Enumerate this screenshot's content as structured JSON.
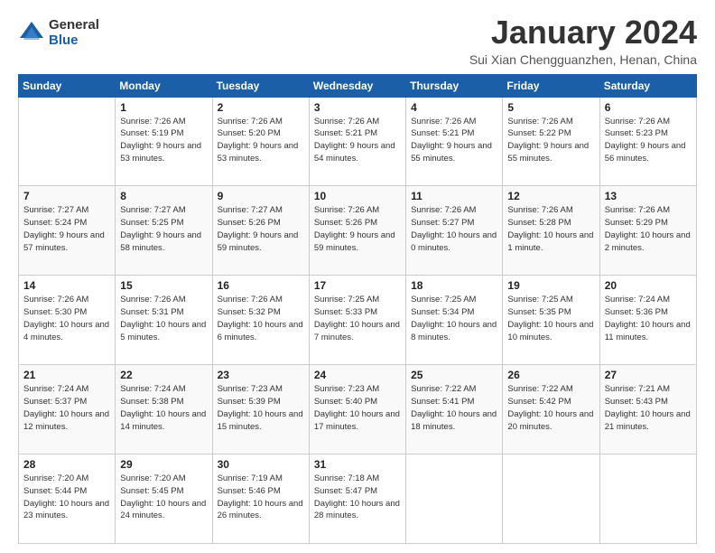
{
  "logo": {
    "general": "General",
    "blue": "Blue"
  },
  "title": {
    "month_year": "January 2024",
    "location": "Sui Xian Chengguanzhen, Henan, China"
  },
  "weekdays": [
    "Sunday",
    "Monday",
    "Tuesday",
    "Wednesday",
    "Thursday",
    "Friday",
    "Saturday"
  ],
  "weeks": [
    [
      {
        "day": "",
        "sunrise": "",
        "sunset": "",
        "daylight": ""
      },
      {
        "day": "1",
        "sunrise": "Sunrise: 7:26 AM",
        "sunset": "Sunset: 5:19 PM",
        "daylight": "Daylight: 9 hours and 53 minutes."
      },
      {
        "day": "2",
        "sunrise": "Sunrise: 7:26 AM",
        "sunset": "Sunset: 5:20 PM",
        "daylight": "Daylight: 9 hours and 53 minutes."
      },
      {
        "day": "3",
        "sunrise": "Sunrise: 7:26 AM",
        "sunset": "Sunset: 5:21 PM",
        "daylight": "Daylight: 9 hours and 54 minutes."
      },
      {
        "day": "4",
        "sunrise": "Sunrise: 7:26 AM",
        "sunset": "Sunset: 5:21 PM",
        "daylight": "Daylight: 9 hours and 55 minutes."
      },
      {
        "day": "5",
        "sunrise": "Sunrise: 7:26 AM",
        "sunset": "Sunset: 5:22 PM",
        "daylight": "Daylight: 9 hours and 55 minutes."
      },
      {
        "day": "6",
        "sunrise": "Sunrise: 7:26 AM",
        "sunset": "Sunset: 5:23 PM",
        "daylight": "Daylight: 9 hours and 56 minutes."
      }
    ],
    [
      {
        "day": "7",
        "sunrise": "Sunrise: 7:27 AM",
        "sunset": "Sunset: 5:24 PM",
        "daylight": "Daylight: 9 hours and 57 minutes."
      },
      {
        "day": "8",
        "sunrise": "Sunrise: 7:27 AM",
        "sunset": "Sunset: 5:25 PM",
        "daylight": "Daylight: 9 hours and 58 minutes."
      },
      {
        "day": "9",
        "sunrise": "Sunrise: 7:27 AM",
        "sunset": "Sunset: 5:26 PM",
        "daylight": "Daylight: 9 hours and 59 minutes."
      },
      {
        "day": "10",
        "sunrise": "Sunrise: 7:26 AM",
        "sunset": "Sunset: 5:26 PM",
        "daylight": "Daylight: 9 hours and 59 minutes."
      },
      {
        "day": "11",
        "sunrise": "Sunrise: 7:26 AM",
        "sunset": "Sunset: 5:27 PM",
        "daylight": "Daylight: 10 hours and 0 minutes."
      },
      {
        "day": "12",
        "sunrise": "Sunrise: 7:26 AM",
        "sunset": "Sunset: 5:28 PM",
        "daylight": "Daylight: 10 hours and 1 minute."
      },
      {
        "day": "13",
        "sunrise": "Sunrise: 7:26 AM",
        "sunset": "Sunset: 5:29 PM",
        "daylight": "Daylight: 10 hours and 2 minutes."
      }
    ],
    [
      {
        "day": "14",
        "sunrise": "Sunrise: 7:26 AM",
        "sunset": "Sunset: 5:30 PM",
        "daylight": "Daylight: 10 hours and 4 minutes."
      },
      {
        "day": "15",
        "sunrise": "Sunrise: 7:26 AM",
        "sunset": "Sunset: 5:31 PM",
        "daylight": "Daylight: 10 hours and 5 minutes."
      },
      {
        "day": "16",
        "sunrise": "Sunrise: 7:26 AM",
        "sunset": "Sunset: 5:32 PM",
        "daylight": "Daylight: 10 hours and 6 minutes."
      },
      {
        "day": "17",
        "sunrise": "Sunrise: 7:25 AM",
        "sunset": "Sunset: 5:33 PM",
        "daylight": "Daylight: 10 hours and 7 minutes."
      },
      {
        "day": "18",
        "sunrise": "Sunrise: 7:25 AM",
        "sunset": "Sunset: 5:34 PM",
        "daylight": "Daylight: 10 hours and 8 minutes."
      },
      {
        "day": "19",
        "sunrise": "Sunrise: 7:25 AM",
        "sunset": "Sunset: 5:35 PM",
        "daylight": "Daylight: 10 hours and 10 minutes."
      },
      {
        "day": "20",
        "sunrise": "Sunrise: 7:24 AM",
        "sunset": "Sunset: 5:36 PM",
        "daylight": "Daylight: 10 hours and 11 minutes."
      }
    ],
    [
      {
        "day": "21",
        "sunrise": "Sunrise: 7:24 AM",
        "sunset": "Sunset: 5:37 PM",
        "daylight": "Daylight: 10 hours and 12 minutes."
      },
      {
        "day": "22",
        "sunrise": "Sunrise: 7:24 AM",
        "sunset": "Sunset: 5:38 PM",
        "daylight": "Daylight: 10 hours and 14 minutes."
      },
      {
        "day": "23",
        "sunrise": "Sunrise: 7:23 AM",
        "sunset": "Sunset: 5:39 PM",
        "daylight": "Daylight: 10 hours and 15 minutes."
      },
      {
        "day": "24",
        "sunrise": "Sunrise: 7:23 AM",
        "sunset": "Sunset: 5:40 PM",
        "daylight": "Daylight: 10 hours and 17 minutes."
      },
      {
        "day": "25",
        "sunrise": "Sunrise: 7:22 AM",
        "sunset": "Sunset: 5:41 PM",
        "daylight": "Daylight: 10 hours and 18 minutes."
      },
      {
        "day": "26",
        "sunrise": "Sunrise: 7:22 AM",
        "sunset": "Sunset: 5:42 PM",
        "daylight": "Daylight: 10 hours and 20 minutes."
      },
      {
        "day": "27",
        "sunrise": "Sunrise: 7:21 AM",
        "sunset": "Sunset: 5:43 PM",
        "daylight": "Daylight: 10 hours and 21 minutes."
      }
    ],
    [
      {
        "day": "28",
        "sunrise": "Sunrise: 7:20 AM",
        "sunset": "Sunset: 5:44 PM",
        "daylight": "Daylight: 10 hours and 23 minutes."
      },
      {
        "day": "29",
        "sunrise": "Sunrise: 7:20 AM",
        "sunset": "Sunset: 5:45 PM",
        "daylight": "Daylight: 10 hours and 24 minutes."
      },
      {
        "day": "30",
        "sunrise": "Sunrise: 7:19 AM",
        "sunset": "Sunset: 5:46 PM",
        "daylight": "Daylight: 10 hours and 26 minutes."
      },
      {
        "day": "31",
        "sunrise": "Sunrise: 7:18 AM",
        "sunset": "Sunset: 5:47 PM",
        "daylight": "Daylight: 10 hours and 28 minutes."
      },
      {
        "day": "",
        "sunrise": "",
        "sunset": "",
        "daylight": ""
      },
      {
        "day": "",
        "sunrise": "",
        "sunset": "",
        "daylight": ""
      },
      {
        "day": "",
        "sunrise": "",
        "sunset": "",
        "daylight": ""
      }
    ]
  ]
}
